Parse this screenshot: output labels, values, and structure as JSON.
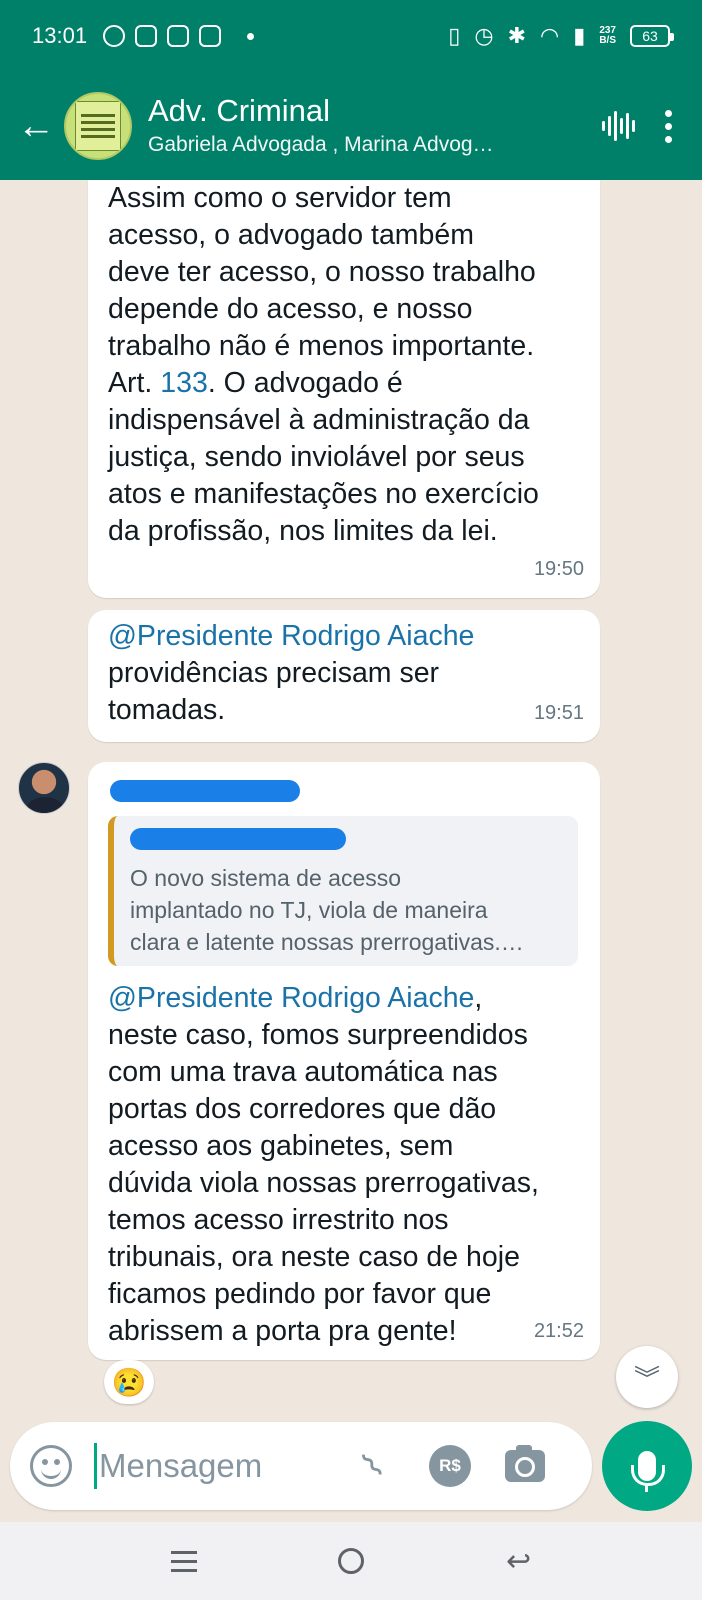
{
  "status_bar": {
    "time": "13:01",
    "speed_top": "237",
    "speed_unit": "B/S",
    "battery": "63"
  },
  "header": {
    "title": "Adv. Criminal",
    "subtitle": "Gabriela Advogada , Marina Advog…"
  },
  "messages": [
    {
      "text_before": "Assim como o servidor tem\nacesso, o advogado também\ndeve ter acesso, o nosso trabalho\ndepende do acesso, e nosso\ntrabalho não é menos importante.\nArt. ",
      "link": "133",
      "text_after": ". O advogado é\nindispensável à administração da\njustiça, sendo inviolável por seus\natos e manifestações no exercício\nda profissão, nos limites da lei.",
      "time": "19:50"
    },
    {
      "mention": "@Presidente Rodrigo Aiache",
      "text": "providências precisam ser\ntomadas.",
      "time": "19:51"
    },
    {
      "quoted_text": "O novo sistema de acesso\nimplantado no TJ, viola de maneira\nclara e latente nossas prerrogativas.…",
      "mention": "@Presidente Rodrigo Aiache",
      "text": "neste caso, fomos surpreendidos\ncom uma trava automática nas\nportas dos corredores que dão\nacesso aos gabinetes, sem\ndúvida viola nossas prerrogativas,\ntemos acesso irrestrito nos\ntribunais, ora neste caso de hoje\nficamos pedindo por favor que\nabrissem a porta pra gente!",
      "time": "21:52",
      "reaction": "😢"
    }
  ],
  "composer": {
    "placeholder": "Mensagem",
    "pay_label": "R$"
  },
  "colors": {
    "header": "#008069",
    "accent": "#00a884",
    "mention": "#1a73a8",
    "chat_bg": "#efe7de"
  }
}
